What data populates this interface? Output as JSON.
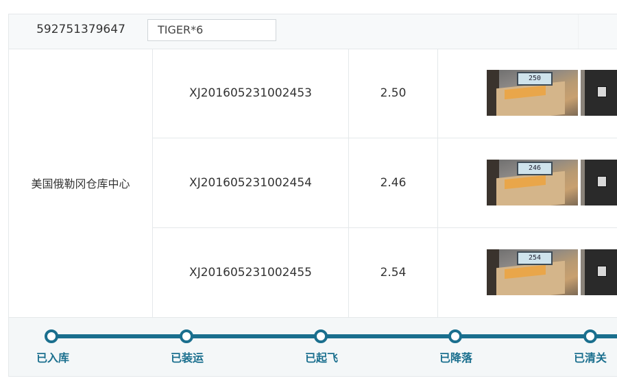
{
  "header": {
    "tracking_number": "592751379647",
    "product_value": "TIGER*6"
  },
  "warehouse": "美国俄勒冈仓库中心",
  "rows": [
    {
      "order": "XJ201605231002453",
      "weight": "2.50",
      "scale_reading": "250"
    },
    {
      "order": "XJ201605231002454",
      "weight": "2.46",
      "scale_reading": "246"
    },
    {
      "order": "XJ201605231002455",
      "weight": "2.54",
      "scale_reading": "254"
    }
  ],
  "timeline": {
    "color": "#1a6f8e",
    "steps": [
      {
        "label": "已入库"
      },
      {
        "label": "已装运"
      },
      {
        "label": "已起飞"
      },
      {
        "label": "已降落"
      },
      {
        "label": "已清关"
      }
    ]
  }
}
